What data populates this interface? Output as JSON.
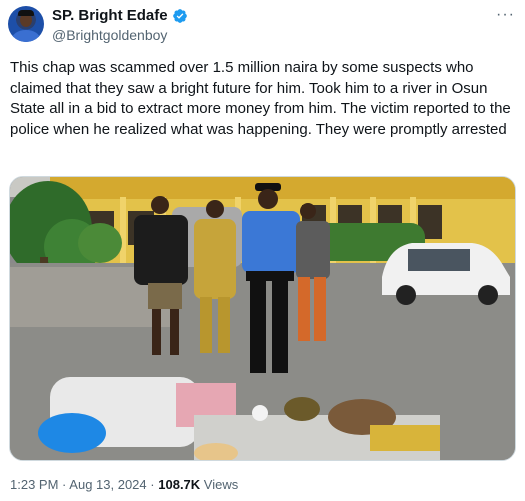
{
  "author": {
    "display_name": "SP. Bright Edafe",
    "handle": "@Brightgoldenboy",
    "verified_badge_icon": "verified-badge-icon",
    "verified_color": "#1d9bf0"
  },
  "more_icon": "more-options-icon",
  "tweet": {
    "text": "This chap was scammed over 1.5 million naira by some suspects who claimed that they saw a bright future for him. Took him to a river in Osun State all in a bid to extract more money from him. The victim reported to the police when he realized what was happening. They were promptly arrested"
  },
  "meta": {
    "time": "1:23 PM",
    "separator": "·",
    "date": "Aug 13, 2024",
    "views_count": "108.7K",
    "views_label": "Views"
  },
  "colors": {
    "secondary_text": "#536471",
    "primary_text": "#0f1419"
  }
}
